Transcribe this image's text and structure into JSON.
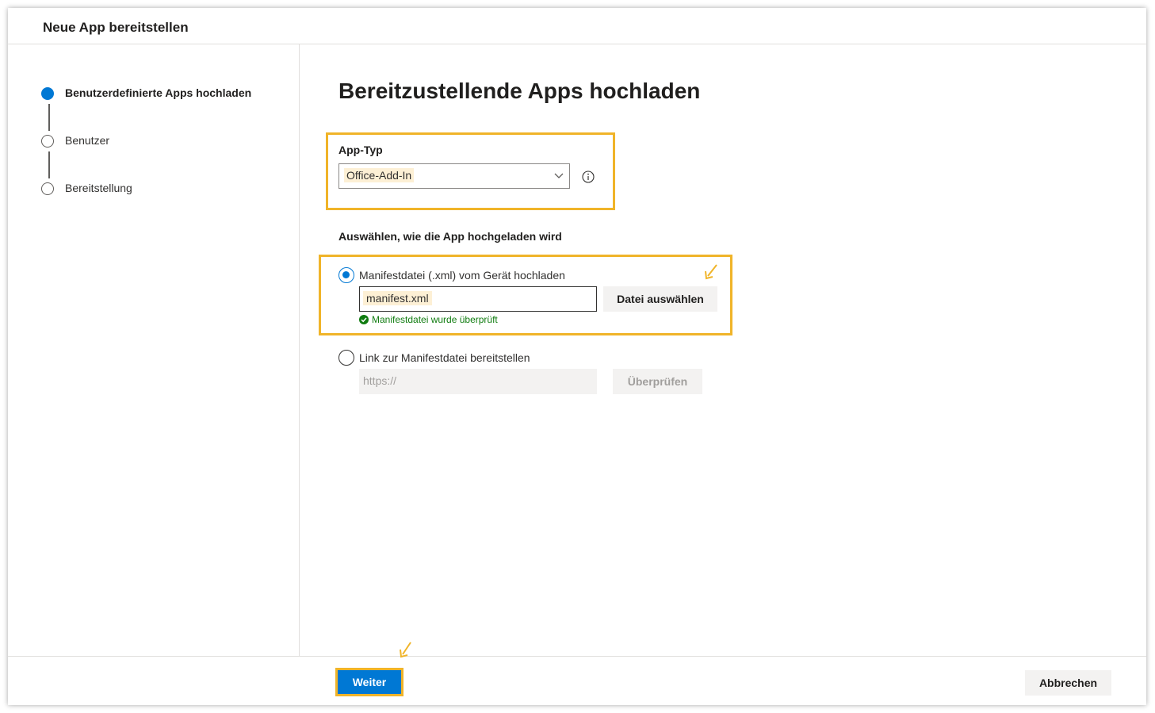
{
  "dialog": {
    "title": "Neue App bereitstellen"
  },
  "steps": [
    {
      "label": "Benutzerdefinierte Apps hochladen",
      "state": "active"
    },
    {
      "label": "Benutzer",
      "state": "inactive"
    },
    {
      "label": "Bereitstellung",
      "state": "inactive"
    }
  ],
  "main": {
    "heading": "Bereitzustellende Apps hochladen",
    "app_type": {
      "label": "App-Typ",
      "selected": "Office-Add-In",
      "info_icon": "info-icon"
    },
    "upload_section_label": "Auswählen, wie die App hochgeladen wird",
    "option_file": {
      "label": "Manifestdatei (.xml) vom Gerät hochladen",
      "checked": true,
      "file_value": "manifest.xml",
      "browse_button": "Datei auswählen",
      "status": "Manifestdatei wurde überprüft"
    },
    "option_link": {
      "label": "Link zur Manifestdatei bereitstellen",
      "checked": false,
      "placeholder": "https://",
      "verify_button": "Überprüfen"
    }
  },
  "footer": {
    "next_button": "Weiter",
    "cancel_button": "Abbrechen"
  },
  "colors": {
    "accent": "#0078d4",
    "highlight": "#f0b429",
    "success": "#107c10"
  }
}
